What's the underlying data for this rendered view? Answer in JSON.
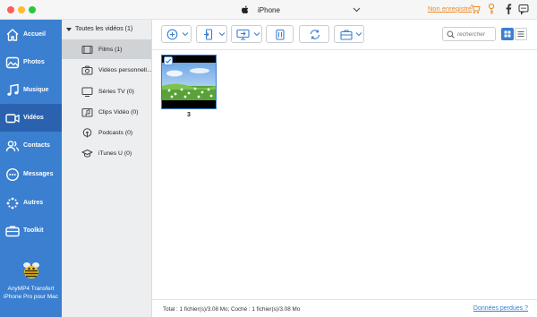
{
  "device": {
    "name": "iPhone"
  },
  "header": {
    "not_registered": "Non enregistré"
  },
  "sidebar": {
    "items": [
      {
        "label": "Accueil",
        "icon": "home-icon"
      },
      {
        "label": "Photos",
        "icon": "photos-icon"
      },
      {
        "label": "Musique",
        "icon": "music-icon"
      },
      {
        "label": "Vidéos",
        "icon": "video-camera-icon",
        "active": true
      },
      {
        "label": "Contacts",
        "icon": "contacts-icon"
      },
      {
        "label": "Messages",
        "icon": "messages-icon"
      },
      {
        "label": "Autres",
        "icon": "others-icon"
      },
      {
        "label": "Toolkit",
        "icon": "toolkit-icon"
      }
    ],
    "brand_line1": "AnyMP4 Transfert",
    "brand_line2": "iPhone Pro pour Mac"
  },
  "tree": {
    "root": "Toutes les vidéos (1)",
    "categories": [
      {
        "label": "Films (1)",
        "icon": "film-icon",
        "active": true
      },
      {
        "label": "Vidéos personnell...",
        "icon": "camera-icon"
      },
      {
        "label": "Séries TV (0)",
        "icon": "tv-icon"
      },
      {
        "label": "Clips Vidéo (0)",
        "icon": "music-video-icon"
      },
      {
        "label": "Podcasts (0)",
        "icon": "podcast-icon"
      },
      {
        "label": "iTunes U (0)",
        "icon": "graduation-cap-icon"
      }
    ]
  },
  "search": {
    "placeholder": "rechercher"
  },
  "video": {
    "name": "3",
    "checked": true
  },
  "status": {
    "text": "Total : 1 fichier(s)/3.08 Mo; Coché : 1 fichier(s)/3.08 Mo",
    "lost_data": "Données perdues ?"
  },
  "colors": {
    "accent": "#3a7fd0",
    "sidebar_active": "#2a62b0",
    "warning": "#f08a24"
  }
}
